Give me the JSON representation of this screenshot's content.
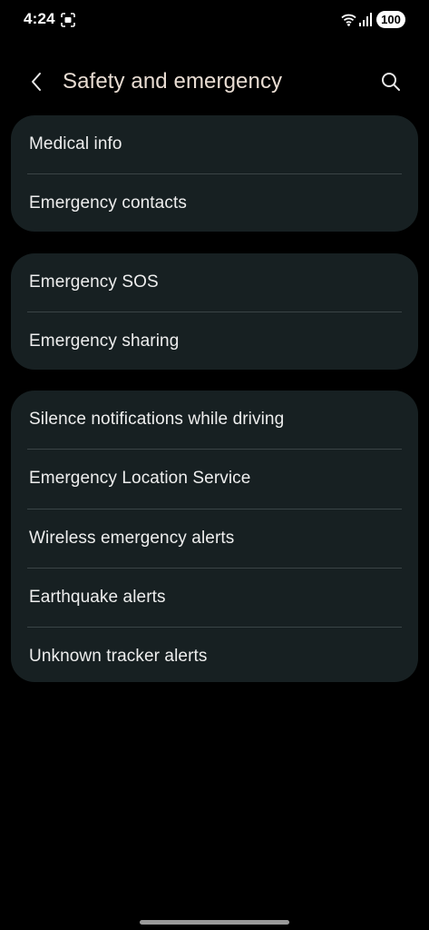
{
  "status_bar": {
    "time": "4:24",
    "battery": "100",
    "icons": [
      "screenshot-icon",
      "wifi-icon",
      "signal-icon"
    ]
  },
  "header": {
    "title": "Safety and emergency",
    "back_icon": "chevron-left-icon",
    "search_icon": "search-icon"
  },
  "groups": [
    {
      "items": [
        {
          "label": "Medical info"
        },
        {
          "label": "Emergency contacts"
        }
      ]
    },
    {
      "items": [
        {
          "label": "Emergency SOS"
        },
        {
          "label": "Emergency sharing"
        }
      ]
    },
    {
      "items": [
        {
          "label": "Silence notifications while driving"
        },
        {
          "label": "Emergency Location Service"
        },
        {
          "label": "Wireless emergency alerts"
        },
        {
          "label": "Earthquake alerts"
        },
        {
          "label": "Unknown tracker alerts"
        }
      ]
    }
  ],
  "colors": {
    "background": "#000000",
    "card": "#172022",
    "title": "#e8dcd2",
    "text": "#eeeeee",
    "divider": "#3a4446"
  }
}
